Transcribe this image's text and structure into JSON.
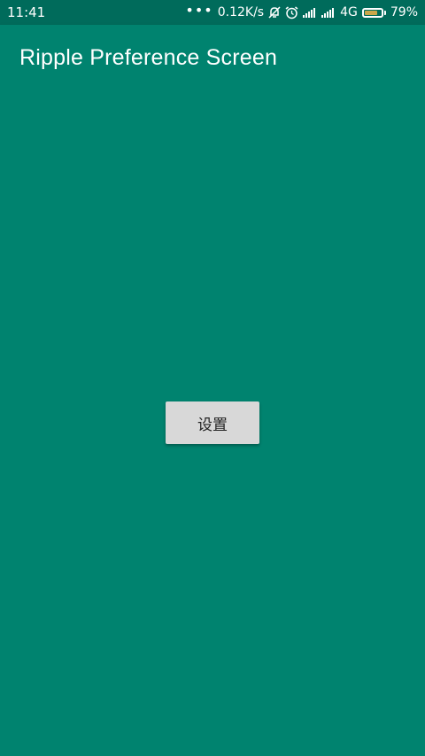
{
  "status_bar": {
    "time": "11:41",
    "dots": "•••",
    "network_speed": "0.12K/s",
    "network_type": "4G",
    "battery_percent_text": "79%",
    "battery_level": 0.79,
    "icons": [
      "mute-icon",
      "alarm-icon",
      "signal-icon",
      "signal-icon",
      "battery-icon"
    ]
  },
  "app_bar": {
    "title": "Ripple Preference Screen"
  },
  "main": {
    "settings_button_label": "设置"
  },
  "colors": {
    "primary": "#00836F",
    "primary_dark": "#006B5B",
    "button_bg": "#D8D8D8"
  }
}
